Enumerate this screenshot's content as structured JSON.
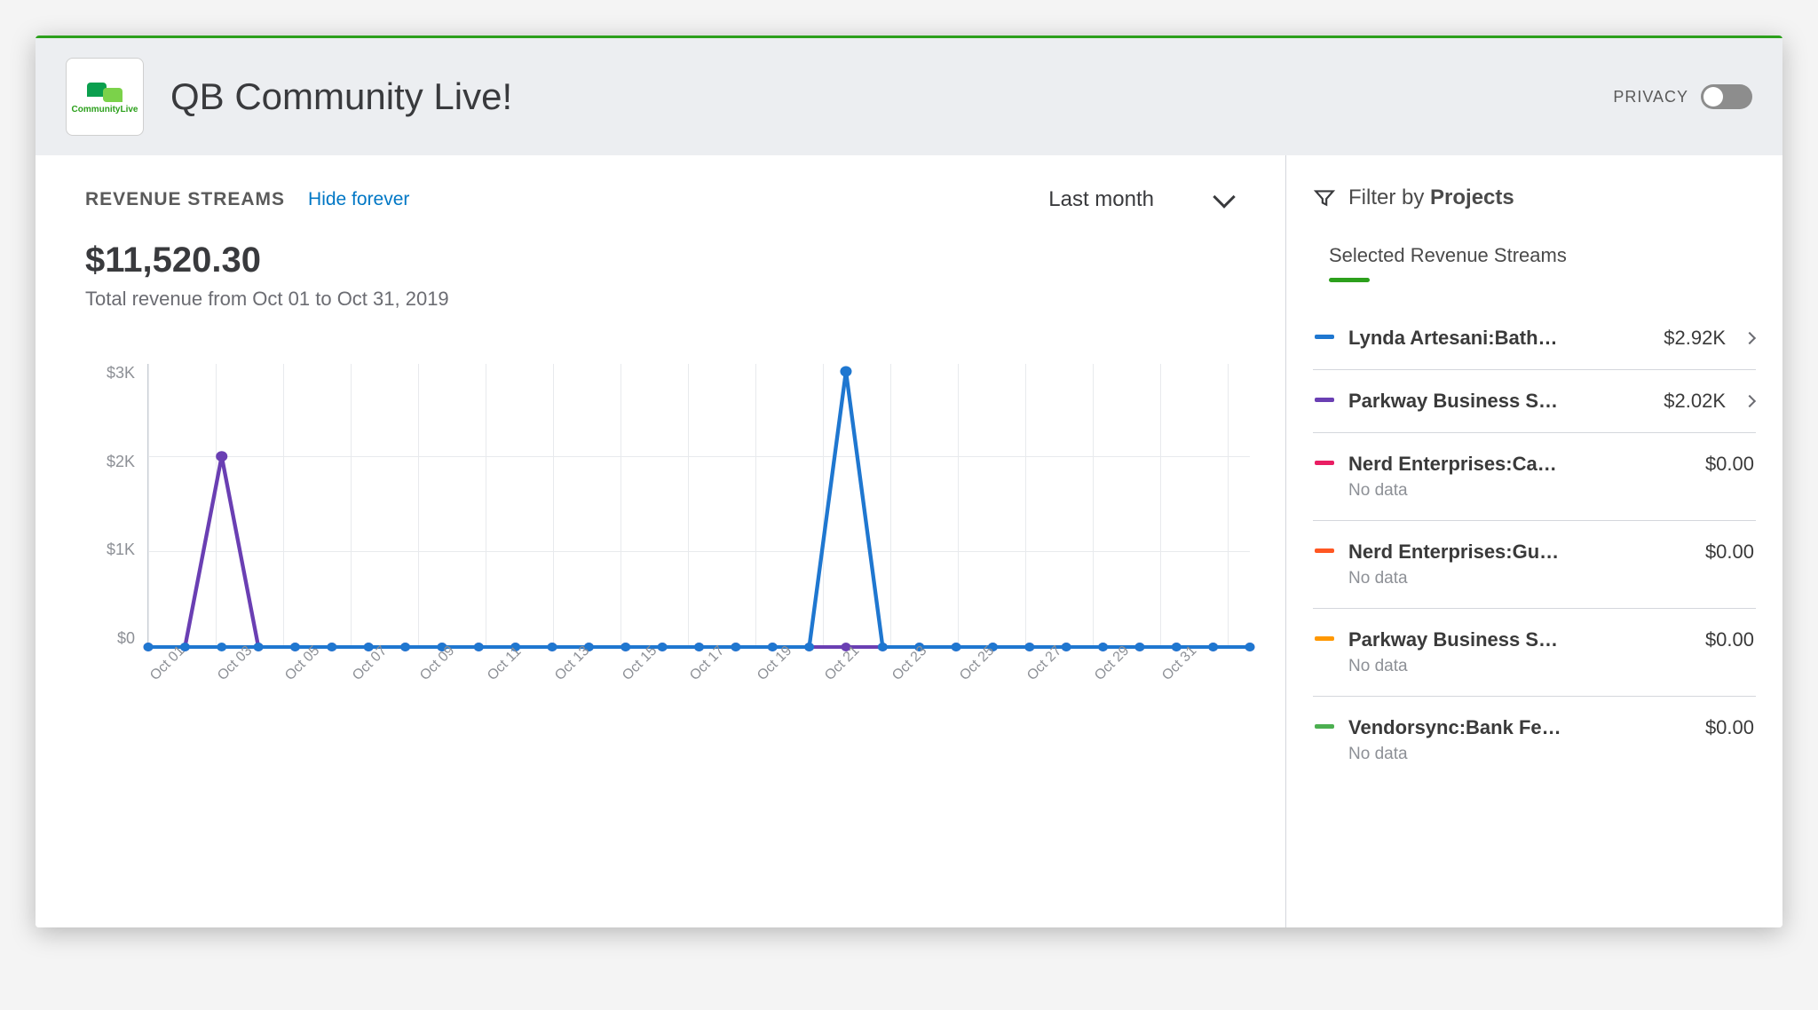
{
  "header": {
    "logo_text": "CommunityLive",
    "page_title": "QB Community Live!",
    "privacy_label": "PRIVACY",
    "privacy_on": false
  },
  "main": {
    "section_title": "REVENUE STREAMS",
    "hide_link": "Hide forever",
    "period_label": "Last month",
    "total_amount": "$11,520.30",
    "total_subtext": "Total revenue from Oct 01 to Oct 31, 2019"
  },
  "side": {
    "filter_prefix": "Filter by ",
    "filter_bold": "Projects",
    "subhead": "Selected Revenue Streams",
    "streams": [
      {
        "color": "#1f77d0",
        "name": "Lynda Artesani:Bath…",
        "sub": "",
        "value": "$2.92K",
        "caret": true
      },
      {
        "color": "#6a3fb3",
        "name": "Parkway Business S…",
        "sub": "",
        "value": "$2.02K",
        "caret": true
      },
      {
        "color": "#e91e63",
        "name": "Nerd Enterprises:Ca…",
        "sub": "No data",
        "value": "$0.00",
        "caret": false
      },
      {
        "color": "#ff5722",
        "name": "Nerd Enterprises:Gu…",
        "sub": "No data",
        "value": "$0.00",
        "caret": false
      },
      {
        "color": "#ff9800",
        "name": "Parkway Business S…",
        "sub": "No data",
        "value": "$0.00",
        "caret": false
      },
      {
        "color": "#4caf50",
        "name": "Vendorsync:Bank Fe…",
        "sub": "No data",
        "value": "$0.00",
        "caret": false
      }
    ]
  },
  "chart_data": {
    "type": "line",
    "title": "Revenue Streams — Last month",
    "xlabel": "",
    "ylabel": "",
    "ylim": [
      0,
      3000
    ],
    "y_ticks": [
      "$3K",
      "$2K",
      "$1K",
      "$0"
    ],
    "categories": [
      "Oct 01",
      "Oct 02",
      "Oct 03",
      "Oct 04",
      "Oct 05",
      "Oct 06",
      "Oct 07",
      "Oct 08",
      "Oct 09",
      "Oct 10",
      "Oct 11",
      "Oct 12",
      "Oct 13",
      "Oct 14",
      "Oct 15",
      "Oct 16",
      "Oct 17",
      "Oct 18",
      "Oct 19",
      "Oct 20",
      "Oct 21",
      "Oct 22",
      "Oct 23",
      "Oct 24",
      "Oct 25",
      "Oct 26",
      "Oct 27",
      "Oct 28",
      "Oct 29",
      "Oct 30",
      "Oct 31"
    ],
    "x_tick_labels": [
      "Oct 01",
      "Oct 03",
      "Oct 05",
      "Oct 07",
      "Oct 09",
      "Oct 11",
      "Oct 13",
      "Oct 15",
      "Oct 17",
      "Oct 19",
      "Oct 21",
      "Oct 23",
      "Oct 25",
      "Oct 27",
      "Oct 29",
      "Oct 31"
    ],
    "series": [
      {
        "name": "Lynda Artesani:Bath…",
        "color": "#1f77d0",
        "values": [
          0,
          0,
          0,
          0,
          0,
          0,
          0,
          0,
          0,
          0,
          0,
          0,
          0,
          0,
          0,
          0,
          0,
          0,
          0,
          2920,
          0,
          0,
          0,
          0,
          0,
          0,
          0,
          0,
          0,
          0,
          0
        ]
      },
      {
        "name": "Parkway Business S…",
        "color": "#6a3fb3",
        "values": [
          0,
          0,
          2020,
          0,
          0,
          0,
          0,
          0,
          0,
          0,
          0,
          0,
          0,
          0,
          0,
          0,
          0,
          0,
          0,
          0,
          0,
          0,
          0,
          0,
          0,
          0,
          0,
          0,
          0,
          0,
          0
        ]
      }
    ]
  }
}
